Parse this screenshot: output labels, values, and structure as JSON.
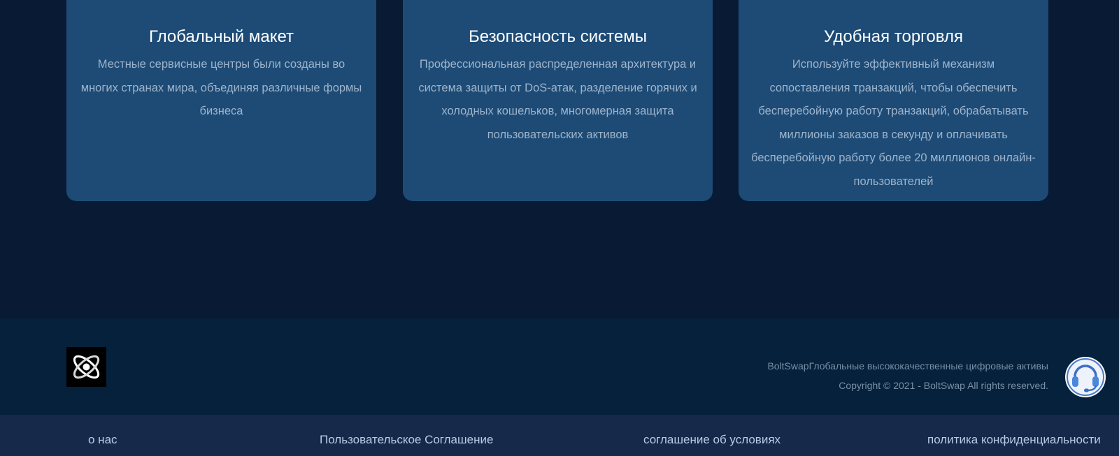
{
  "features": [
    {
      "title": "Глобальный макет",
      "description": "Местные сервисные центры были созданы во многих странах мира, объединяя различные формы бизнеса"
    },
    {
      "title": "Безопасность системы",
      "description": "Профессиональная распределенная архитектура и система защиты от DoS-атак, разделение горячих и холодных кошельков, многомерная защита пользовательских активов"
    },
    {
      "title": "Удобная торговля",
      "description": "Используйте эффективный механизм сопоставления транзакций, чтобы обеспечить бесперебойную работу транзакций, обрабатывать миллионы заказов в секунду и оплачивать бесперебойную работу более 20 миллионов онлайн-пользователей"
    }
  ],
  "footer": {
    "tagline": "BoltSwapГлобальные высококачественные цифровые активы",
    "copyright": "Copyright © 2021 - BoltSwap All rights reserved.",
    "logo_icon": "orbit-logo-icon",
    "support_icon": "headset-icon"
  },
  "bottom_nav": [
    {
      "label": "о нас"
    },
    {
      "label": "Пользовательское Соглашение"
    },
    {
      "label": "соглашение об условиях"
    },
    {
      "label": "политика конфиденциальности"
    }
  ],
  "colors": {
    "page_background": "#081a34",
    "card_background": "#1d4b76",
    "footer_background": "#05213b",
    "bottom_nav_background": "#16294a"
  }
}
